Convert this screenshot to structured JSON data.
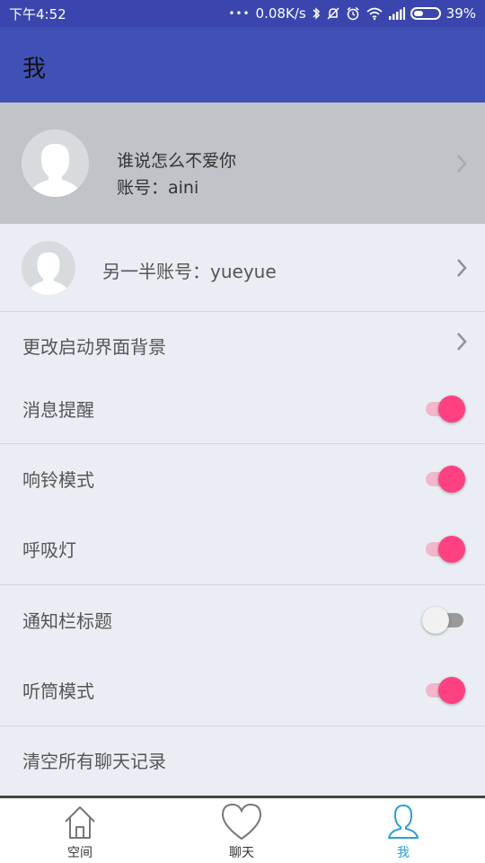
{
  "status_bar": {
    "time": "下午4:52",
    "dots": "•••",
    "network_speed": "0.08K/s",
    "battery_percent": "39%",
    "battery_level": 0.39,
    "icons": [
      "bluetooth-icon",
      "mute-icon",
      "alarm-icon",
      "wifi-icon",
      "signal-icon",
      "battery-icon"
    ]
  },
  "app_bar": {
    "title": "我"
  },
  "profile": {
    "name": "谁说怎么不爱你",
    "account": "账号：aini"
  },
  "partner": {
    "label": "另一半账号：yueyue"
  },
  "settings": {
    "background_label": "更改启动界面背景",
    "message_reminder": {
      "label": "消息提醒",
      "on": true
    },
    "ringtone_mode": {
      "label": "响铃模式",
      "on": true
    },
    "breathing_light": {
      "label": "呼吸灯",
      "on": true
    },
    "notification_title": {
      "label": "通知栏标题",
      "on": false
    },
    "earpiece_mode": {
      "label": "听筒模式",
      "on": true
    },
    "clear_chats_label": "清空所有聊天记录"
  },
  "bottom_nav": {
    "items": [
      {
        "label": "空间",
        "active": false
      },
      {
        "label": "聊天",
        "active": false
      },
      {
        "label": "我",
        "active": true
      }
    ]
  },
  "colors": {
    "status_bar": "#3a46ad",
    "app_bar": "#3f51b5",
    "accent": "#ff4081",
    "active_nav": "#2a9fd6",
    "background": "#eaeef4"
  }
}
